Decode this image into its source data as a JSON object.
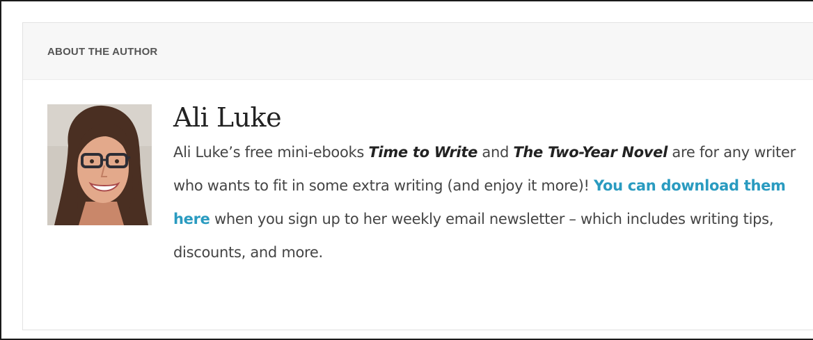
{
  "author_box": {
    "header_label": "ABOUT THE AUTHOR",
    "name": "Ali Luke",
    "bio": {
      "part1": "Ali Luke’s free mini-ebooks ",
      "book1": "Time to Write",
      "part2": " and ",
      "book2": "The Two-Year Novel",
      "part3": " are for any writer who wants to fit in some extra writing (and enjoy it more)! ",
      "link_text": "You can download them here",
      "part4": " when you sign up to her weekly email newsletter – which includes writing tips, discounts, and more."
    },
    "colors": {
      "link": "#2a9bc0",
      "header_bg": "#f7f7f7"
    }
  }
}
